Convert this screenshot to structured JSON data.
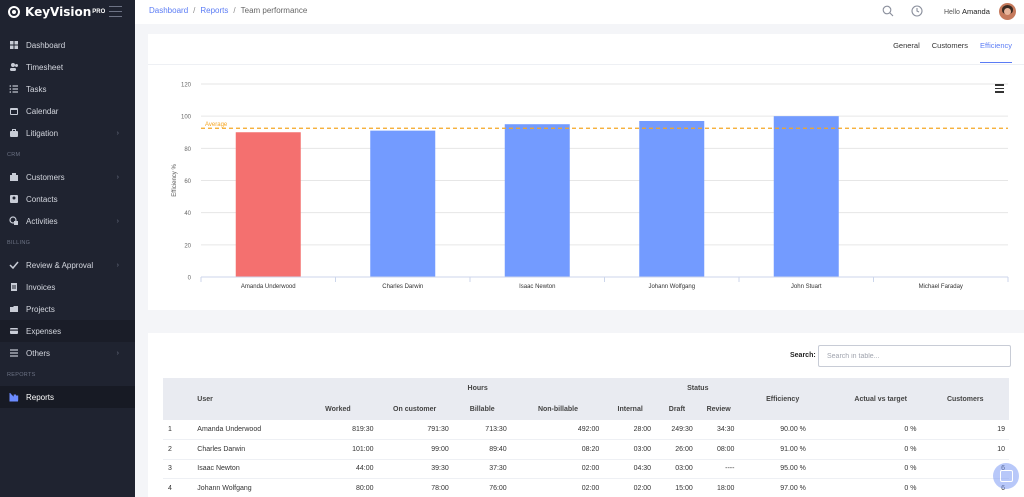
{
  "app": {
    "name": "KeyVision",
    "sup": "PRO"
  },
  "sidebar": {
    "items": [
      {
        "type": "item",
        "label": "Dashboard",
        "icon": "dashboard-icon"
      },
      {
        "type": "item",
        "label": "Timesheet",
        "icon": "users-icon"
      },
      {
        "type": "item",
        "label": "Tasks",
        "icon": "tasks-icon"
      },
      {
        "type": "item",
        "label": "Calendar",
        "icon": "calendar-icon"
      },
      {
        "type": "item",
        "label": "Litigation",
        "icon": "briefcase-icon",
        "chevron": true
      },
      {
        "type": "section",
        "label": "CRM"
      },
      {
        "type": "item",
        "label": "Customers",
        "icon": "building-icon",
        "chevron": true
      },
      {
        "type": "item",
        "label": "Contacts",
        "icon": "contact-icon"
      },
      {
        "type": "item",
        "label": "Activities",
        "icon": "activities-icon",
        "chevron": true
      },
      {
        "type": "section",
        "label": "BILLING"
      },
      {
        "type": "item",
        "label": "Review & Approval",
        "icon": "check-icon",
        "chevron": true
      },
      {
        "type": "item",
        "label": "Invoices",
        "icon": "invoice-icon"
      },
      {
        "type": "item",
        "label": "Projects",
        "icon": "folder-icon"
      },
      {
        "type": "item",
        "label": "Expenses",
        "icon": "card-icon",
        "active": true
      },
      {
        "type": "item",
        "label": "Others",
        "icon": "list-icon",
        "chevron": true
      },
      {
        "type": "section",
        "label": "REPORTS"
      },
      {
        "type": "item",
        "label": "Reports",
        "icon": "chart-icon",
        "selected": true
      }
    ]
  },
  "header": {
    "breadcrumb": [
      "Dashboard",
      "Reports",
      "Team performance"
    ],
    "hello": "Hello",
    "user": "Amanda"
  },
  "tabs": [
    "General",
    "Customers",
    "Efficiency"
  ],
  "active_tab": "Efficiency",
  "chart_data": {
    "type": "bar",
    "categories": [
      "Amanda Underwood",
      "Charles Darwin",
      "Isaac Newton",
      "Johann Wolfgang",
      "John Stuart",
      "Michael Faraday"
    ],
    "values": [
      90,
      91,
      95,
      97,
      100,
      null
    ],
    "colors": [
      "#f4706f",
      "#739bff",
      "#739bff",
      "#739bff",
      "#739bff",
      "#739bff"
    ],
    "ylabel": "Efficiency %",
    "ylim": [
      0,
      120
    ],
    "yticks": [
      0,
      20,
      40,
      60,
      80,
      100,
      120
    ],
    "average": {
      "label": "Average",
      "value": 92.5,
      "color": "#f5a623"
    },
    "grid": true
  },
  "table": {
    "search_label": "Search:",
    "search_placeholder": "Search in table...",
    "group_headers": {
      "hours": "Hours",
      "status": "Status"
    },
    "columns": {
      "user": "User",
      "worked": "Worked",
      "on_customer": "On customer",
      "billable": "Billable",
      "non_billable": "Non-billable",
      "internal": "Internal",
      "draft": "Draft",
      "review": "Review",
      "efficiency": "Efficiency",
      "actual_vs_target": "Actual vs target",
      "customers": "Customers"
    },
    "rows": [
      {
        "n": "1",
        "user": "Amanda Underwood",
        "worked": "819:30",
        "on_customer": "791:30",
        "billable": "713:30",
        "non_billable": "492:00",
        "internal": "28:00",
        "draft": "249:30",
        "review": "34:30",
        "efficiency": "90.00 %",
        "avt": "0 %",
        "customers": "19"
      },
      {
        "n": "2",
        "user": "Charles Darwin",
        "worked": "101:00",
        "on_customer": "99:00",
        "billable": "89:40",
        "non_billable": "08:20",
        "internal": "03:00",
        "draft": "26:00",
        "review": "08:00",
        "efficiency": "91.00 %",
        "avt": "0 %",
        "customers": "10"
      },
      {
        "n": "3",
        "user": "Isaac Newton",
        "worked": "44:00",
        "on_customer": "39:30",
        "billable": "37:30",
        "non_billable": "02:00",
        "internal": "04:30",
        "draft": "03:00",
        "review": "----",
        "efficiency": "95.00 %",
        "avt": "0 %",
        "customers": "6"
      },
      {
        "n": "4",
        "user": "Johann Wolfgang",
        "worked": "80:00",
        "on_customer": "78:00",
        "billable": "76:00",
        "non_billable": "02:00",
        "internal": "02:00",
        "draft": "15:00",
        "review": "18:00",
        "efficiency": "97.00 %",
        "avt": "0 %",
        "customers": "6"
      }
    ]
  }
}
